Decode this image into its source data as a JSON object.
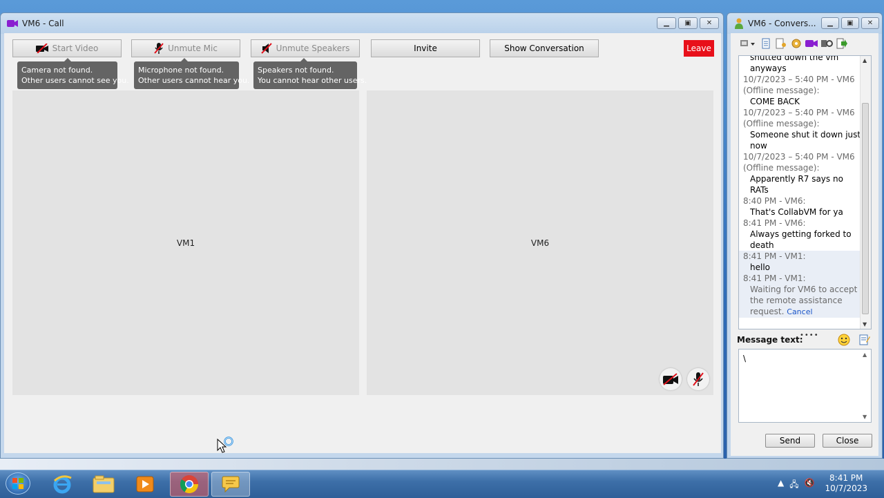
{
  "call_window": {
    "title": "VM6 - Call",
    "toolbar": {
      "start_video": "Start Video",
      "unmute_mic": "Unmute Mic",
      "unmute_speakers": "Unmute Speakers",
      "invite": "Invite",
      "show_conversation": "Show Conversation",
      "leave": "Leave"
    },
    "tooltips": [
      {
        "line1": "Camera not found.",
        "line2": "Other users cannot see you."
      },
      {
        "line1": "Microphone not found.",
        "line2": "Other users cannot hear you."
      },
      {
        "line1": "Speakers not found.",
        "line2": "You cannot hear other users."
      }
    ],
    "participants": [
      "VM1",
      "VM6"
    ]
  },
  "conversation_window": {
    "title": "VM6 - Convers...",
    "history": [
      {
        "kind": "msg",
        "text": "shutted down the vm"
      },
      {
        "kind": "msg",
        "text": "anyways"
      },
      {
        "kind": "meta",
        "text": "10/7/2023 – 5:40 PM - VM6"
      },
      {
        "kind": "meta",
        "text": "(Offline message):"
      },
      {
        "kind": "msg",
        "text": "COME BACK"
      },
      {
        "kind": "meta",
        "text": "10/7/2023 – 5:40 PM - VM6"
      },
      {
        "kind": "meta",
        "text": "(Offline message):"
      },
      {
        "kind": "msg",
        "text": "Someone shut it down just"
      },
      {
        "kind": "msg",
        "text": "now"
      },
      {
        "kind": "meta",
        "text": "10/7/2023 – 5:40 PM - VM6"
      },
      {
        "kind": "meta",
        "text": "(Offline message):"
      },
      {
        "kind": "msg",
        "text": "Apparently R7 says no"
      },
      {
        "kind": "msg",
        "text": "RATs"
      },
      {
        "kind": "meta",
        "text": "8:40 PM - VM6:"
      },
      {
        "kind": "msg",
        "text": "That's CollabVM for ya"
      },
      {
        "kind": "meta",
        "text": "8:41 PM - VM6:"
      },
      {
        "kind": "msg",
        "text": "Always getting forked to"
      },
      {
        "kind": "msg",
        "text": "death"
      },
      {
        "kind": "meta",
        "text": "8:41 PM - VM1:",
        "hl": true
      },
      {
        "kind": "msg",
        "text": "hello",
        "hl": true
      },
      {
        "kind": "meta",
        "text": "8:41 PM - VM1:",
        "hl": true
      },
      {
        "kind": "pending",
        "text": "Waiting for VM6 to accept",
        "hl": true
      },
      {
        "kind": "pending",
        "text": "the remote assistance",
        "hl": true
      },
      {
        "kind": "pending",
        "text": "request.",
        "hl": true
      }
    ],
    "cancel_link": "Cancel",
    "message_label": "Message text:",
    "message_value": "\\",
    "send": "Send",
    "close": "Close"
  },
  "taskbar": {
    "time": "8:41 PM",
    "date": "10/7/2023",
    "apps": [
      "windows-explorer-ie",
      "file-explorer",
      "media-player",
      "chrome",
      "messenger"
    ]
  }
}
